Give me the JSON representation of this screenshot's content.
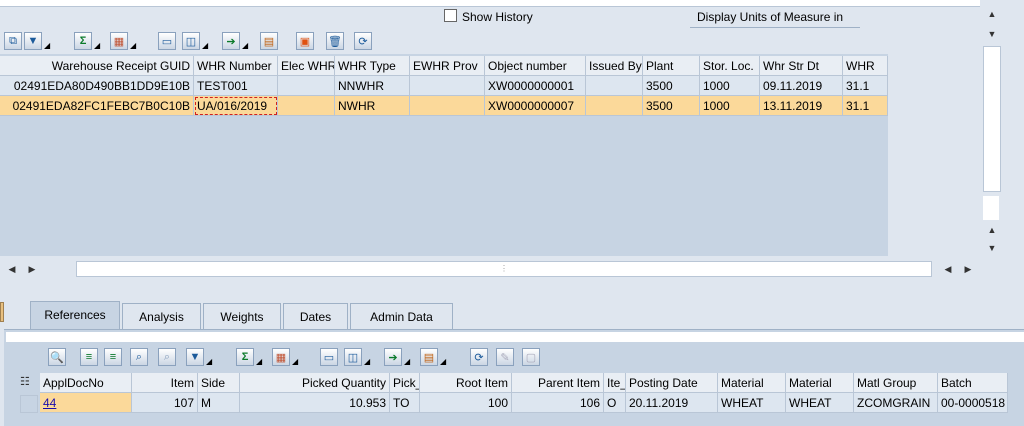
{
  "top": {
    "show_history_label": "Show History",
    "display_units_label": "Display Units of Measure in"
  },
  "grid1": {
    "columns": [
      "Warehouse Receipt GUID",
      "WHR Number",
      "Elec WHR",
      "WHR Type",
      "EWHR Prov",
      "Object number",
      "Issued By",
      "Plant",
      "Stor. Loc.",
      "Whr Str Dt",
      "WHR"
    ],
    "rows": [
      [
        "02491EDA80D490BB1DD9E10B",
        "TEST001",
        "",
        "NNWHR",
        "",
        "XW0000000001",
        "",
        "3500",
        "1000",
        "09.11.2019",
        "31.1"
      ],
      [
        "02491EDA82FC1FEBC7B0C10B",
        "UA/016/2019",
        "",
        "NWHR",
        "",
        "XW0000000007",
        "",
        "3500",
        "1000",
        "13.11.2019",
        "31.1"
      ]
    ]
  },
  "tabs": [
    "References",
    "Analysis",
    "Weights",
    "Dates",
    "Admin Data"
  ],
  "grid2": {
    "columns": [
      "ApplDocNo",
      "Item",
      "Side",
      "Picked Quantity",
      "Pick_",
      "Root Item",
      "Parent Item",
      "Ite_",
      "Posting Date",
      "Material",
      "Material",
      "Matl Group",
      "Batch"
    ],
    "row": [
      "44",
      "107",
      "M",
      "10.953",
      "TO",
      "100",
      "106",
      "O",
      "20.11.2019",
      "WHEAT",
      "WHEAT",
      "ZCOMGRAIN",
      "00-0000518"
    ]
  },
  "colors": {
    "accent": "#fbd99a",
    "grid": "#c7d4e3",
    "header": "#e9eef4",
    "link": "#1a0dab"
  }
}
